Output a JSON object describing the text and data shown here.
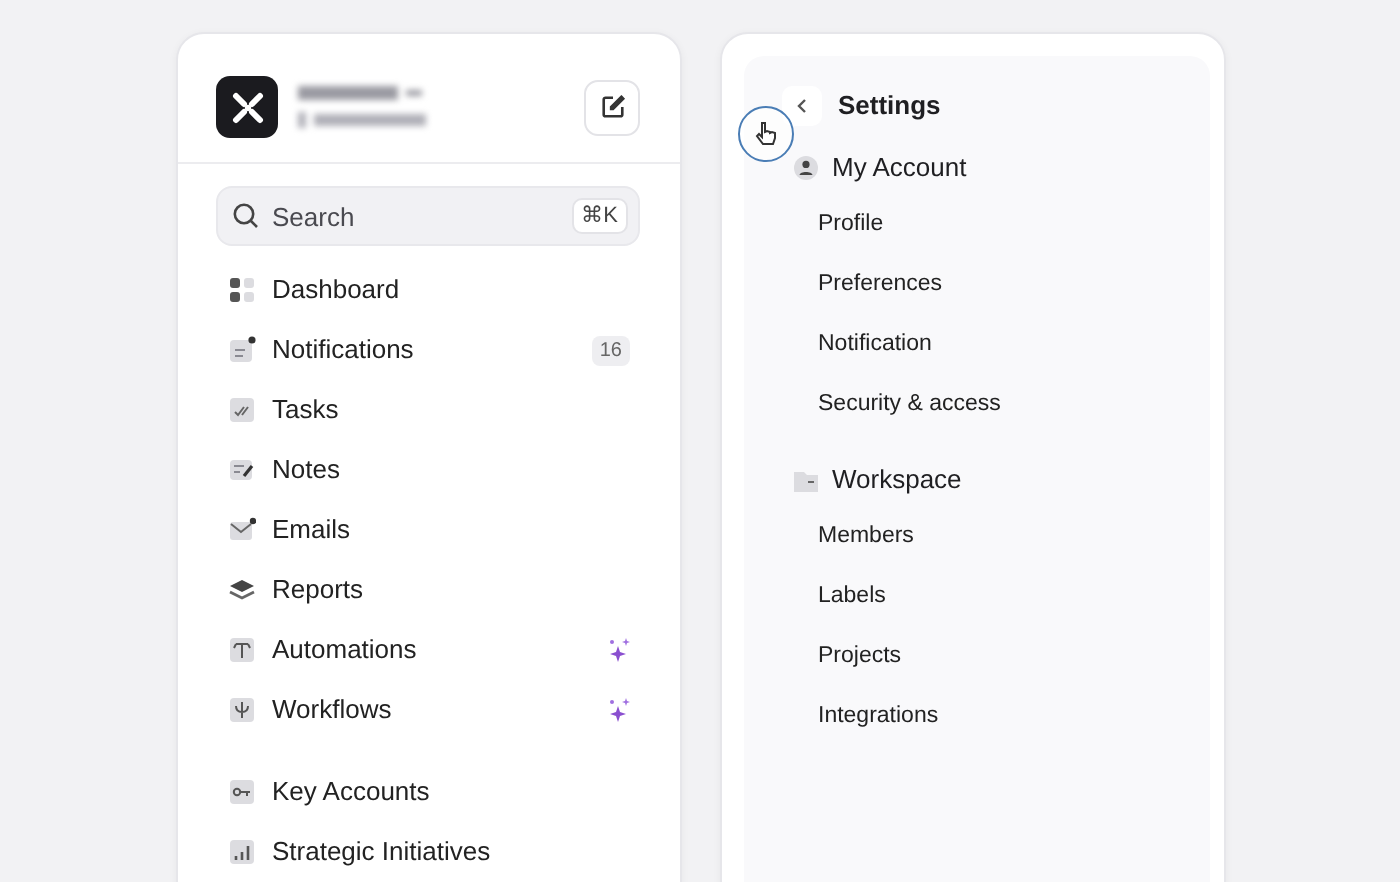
{
  "sidebar": {
    "search": {
      "placeholder": "Search",
      "shortcut": "⌘K"
    },
    "sections": [
      {
        "items": [
          {
            "label": "Dashboard",
            "sparkle": false
          },
          {
            "label": "Notifications",
            "count": "16",
            "sparkle": false
          },
          {
            "label": "Tasks",
            "sparkle": false
          },
          {
            "label": "Notes",
            "sparkle": false
          },
          {
            "label": "Emails",
            "sparkle": false
          },
          {
            "label": "Reports",
            "sparkle": false
          },
          {
            "label": "Automations",
            "sparkle": true
          },
          {
            "label": "Workflows",
            "sparkle": true
          }
        ]
      },
      {
        "items": [
          {
            "label": "Key Accounts",
            "sparkle": false
          },
          {
            "label": "Strategic Initiatives",
            "sparkle": false
          }
        ]
      }
    ]
  },
  "settings": {
    "title": "Settings",
    "groups": [
      {
        "title": "My Account",
        "children": [
          {
            "label": "Profile"
          },
          {
            "label": "Preferences"
          },
          {
            "label": "Notification"
          },
          {
            "label": "Security & access"
          }
        ]
      },
      {
        "title": "Workspace",
        "children": [
          {
            "label": "Members"
          },
          {
            "label": "Labels"
          },
          {
            "label": "Projects"
          },
          {
            "label": "Integrations"
          }
        ]
      }
    ]
  }
}
